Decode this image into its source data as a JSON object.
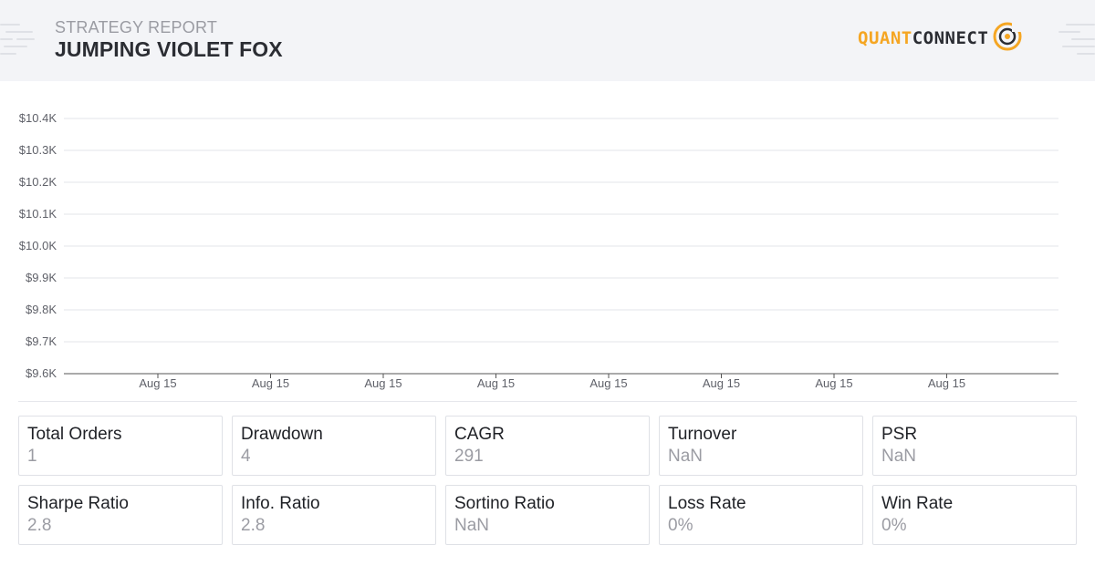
{
  "header": {
    "subtitle": "STRATEGY REPORT",
    "title": "JUMPING VIOLET FOX",
    "logo_text_1": "QUANT",
    "logo_text_2": "CONNECT",
    "logo_icon": "quantconnect-ring-icon",
    "brand_color": "#f5a623"
  },
  "chart_data": {
    "type": "line",
    "title": "",
    "xlabel": "",
    "ylabel": "",
    "y_tick_labels": [
      "$10.4K",
      "$10.3K",
      "$10.2K",
      "$10.1K",
      "$10.0K",
      "$9.9K",
      "$9.8K",
      "$9.7K",
      "$9.6K"
    ],
    "ylim": [
      9600,
      10400
    ],
    "x_tick_labels": [
      "Aug 15",
      "Aug 15",
      "Aug 15",
      "Aug 15",
      "Aug 15",
      "Aug 15",
      "Aug 15",
      "Aug 15"
    ],
    "grid": true,
    "series": []
  },
  "stats": [
    {
      "label": "Total Orders",
      "value": "1"
    },
    {
      "label": "Drawdown",
      "value": "4"
    },
    {
      "label": "CAGR",
      "value": "291"
    },
    {
      "label": "Turnover",
      "value": "NaN"
    },
    {
      "label": "PSR",
      "value": "NaN"
    },
    {
      "label": "Sharpe Ratio",
      "value": "2.8"
    },
    {
      "label": "Info. Ratio",
      "value": "2.8"
    },
    {
      "label": "Sortino Ratio",
      "value": "NaN"
    },
    {
      "label": "Loss Rate",
      "value": "0%"
    },
    {
      "label": "Win Rate",
      "value": "0%"
    }
  ]
}
